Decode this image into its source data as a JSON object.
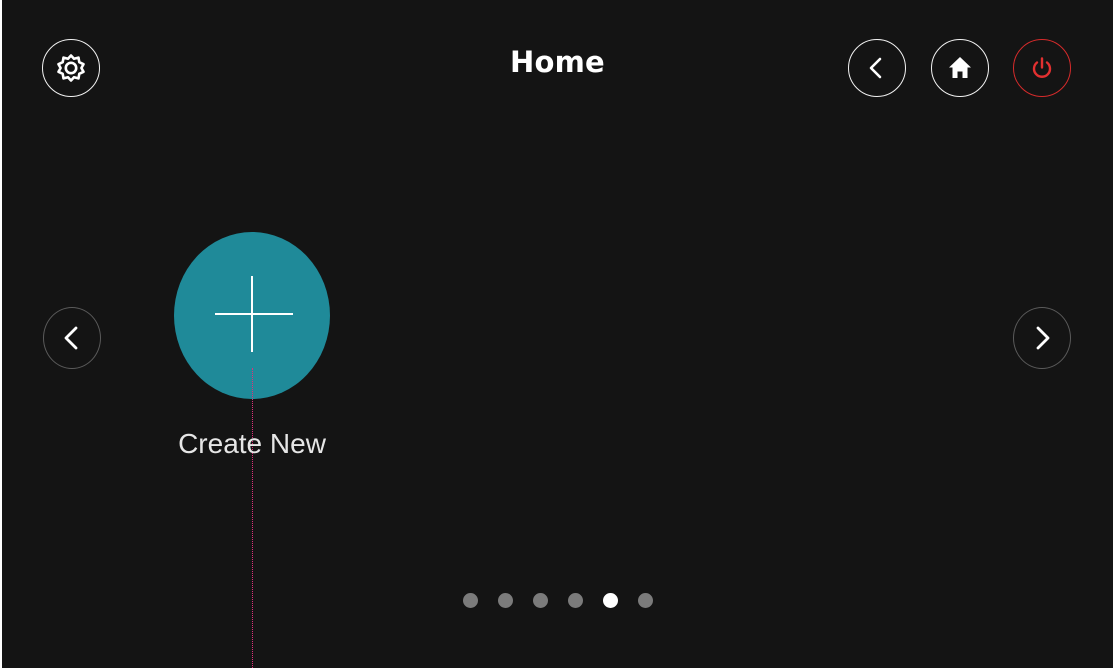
{
  "header": {
    "title": "Home",
    "settings_icon": "gear-icon",
    "back_icon": "chevron-left-icon",
    "home_icon": "home-icon",
    "power_icon": "power-icon"
  },
  "tiles": [
    {
      "label": "Create New",
      "icon": "plus-icon",
      "color": "#1f8a99"
    }
  ],
  "navigation": {
    "prev_icon": "chevron-left-icon",
    "next_icon": "chevron-right-icon"
  },
  "pagination": {
    "page_count": 6,
    "active_page": 5
  },
  "colors": {
    "background": "#141414",
    "accent": "#1f8a99",
    "power": "#d62b2b",
    "dot_inactive": "#7b7b7b",
    "dot_active": "#ffffff"
  }
}
